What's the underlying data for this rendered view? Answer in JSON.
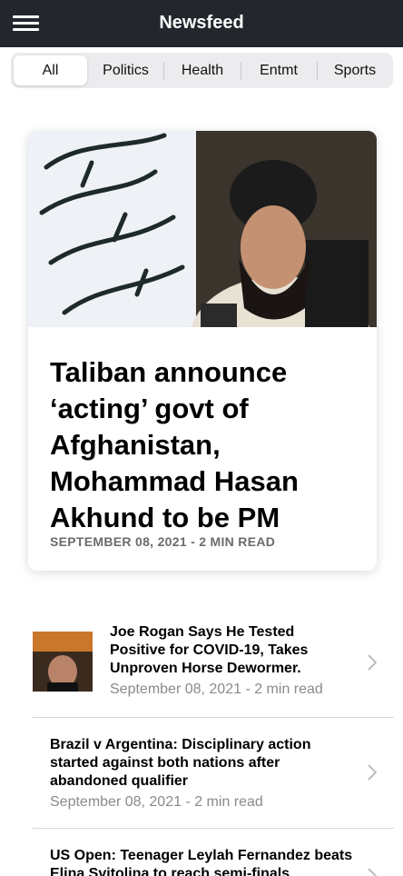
{
  "header": {
    "title": "Newsfeed",
    "menu_icon": "hamburger-menu-icon"
  },
  "tabs": [
    {
      "label": "All",
      "active": true
    },
    {
      "label": "Politics",
      "active": false
    },
    {
      "label": "Health",
      "active": false
    },
    {
      "label": "Entmt",
      "active": false
    },
    {
      "label": "Sports",
      "active": false
    }
  ],
  "featured": {
    "headline": "Taliban announce ‘acting’ govt of Afghanistan, Mohammad Hasan Akhund to be PM",
    "meta": "SEPTEMBER 08, 2021 - 2 MIN READ"
  },
  "articles": [
    {
      "title": "Joe Rogan Says He Tested Positive for COVID-19, Takes Unproven Horse Dewormer.",
      "meta": "September 08, 2021 - 2 min read",
      "has_thumbnail": true
    },
    {
      "title": "Brazil v Argentina: Disciplinary action started against both nations after abandoned qualifier",
      "meta": "September 08, 2021 - 2 min read",
      "has_thumbnail": false
    },
    {
      "title": "US Open: Teenager Leylah Fernandez beats Elina Svitolina to reach semi-finals",
      "meta": "",
      "has_thumbnail": false
    }
  ],
  "colors": {
    "topbar": "#23272d",
    "segment_bg": "#ececee",
    "meta_gray": "#8a8a8a"
  }
}
